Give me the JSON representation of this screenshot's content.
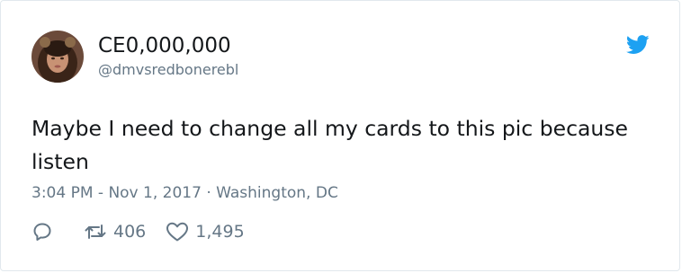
{
  "tweet": {
    "display_name": "CE0,000,000",
    "handle": "@dmvsredbonerebl",
    "text": "Maybe I need to change all my cards to this pic because listen",
    "timestamp": "3:04 PM - Nov 1, 2017",
    "separator": "·",
    "location": "Washington, DC",
    "retweets": "406",
    "likes": "1,495"
  },
  "icons": {
    "avatar": "avatar-photo",
    "brand": "twitter-bird-icon",
    "reply": "reply-icon",
    "retweet": "retweet-icon",
    "like": "heart-icon"
  },
  "colors": {
    "brand_blue": "#1da1f2",
    "text_primary": "#14171a",
    "text_secondary": "#657786",
    "border": "#e1e8ed"
  }
}
